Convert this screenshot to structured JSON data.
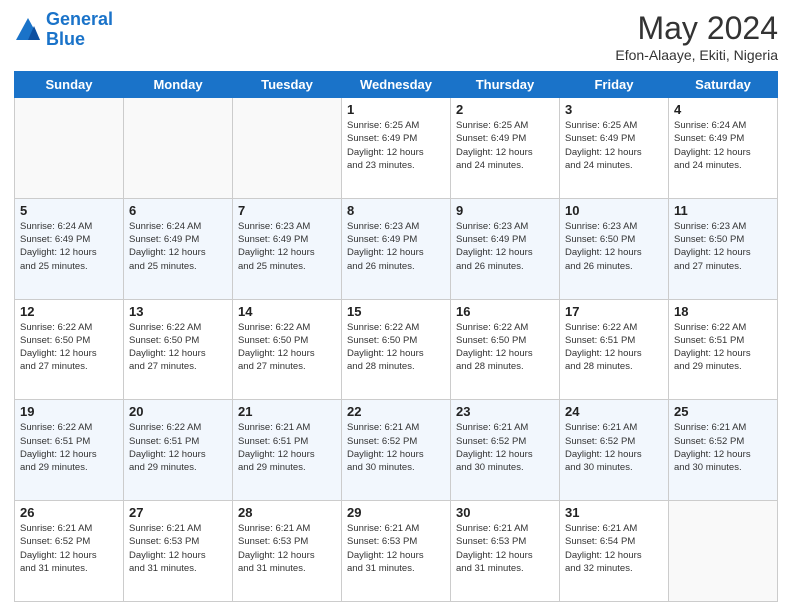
{
  "header": {
    "logo_line1": "General",
    "logo_line2": "Blue",
    "month_year": "May 2024",
    "location": "Efon-Alaaye, Ekiti, Nigeria"
  },
  "days_of_week": [
    "Sunday",
    "Monday",
    "Tuesday",
    "Wednesday",
    "Thursday",
    "Friday",
    "Saturday"
  ],
  "weeks": [
    [
      {
        "day": "",
        "info": ""
      },
      {
        "day": "",
        "info": ""
      },
      {
        "day": "",
        "info": ""
      },
      {
        "day": "1",
        "info": "Sunrise: 6:25 AM\nSunset: 6:49 PM\nDaylight: 12 hours\nand 23 minutes."
      },
      {
        "day": "2",
        "info": "Sunrise: 6:25 AM\nSunset: 6:49 PM\nDaylight: 12 hours\nand 24 minutes."
      },
      {
        "day": "3",
        "info": "Sunrise: 6:25 AM\nSunset: 6:49 PM\nDaylight: 12 hours\nand 24 minutes."
      },
      {
        "day": "4",
        "info": "Sunrise: 6:24 AM\nSunset: 6:49 PM\nDaylight: 12 hours\nand 24 minutes."
      }
    ],
    [
      {
        "day": "5",
        "info": "Sunrise: 6:24 AM\nSunset: 6:49 PM\nDaylight: 12 hours\nand 25 minutes."
      },
      {
        "day": "6",
        "info": "Sunrise: 6:24 AM\nSunset: 6:49 PM\nDaylight: 12 hours\nand 25 minutes."
      },
      {
        "day": "7",
        "info": "Sunrise: 6:23 AM\nSunset: 6:49 PM\nDaylight: 12 hours\nand 25 minutes."
      },
      {
        "day": "8",
        "info": "Sunrise: 6:23 AM\nSunset: 6:49 PM\nDaylight: 12 hours\nand 26 minutes."
      },
      {
        "day": "9",
        "info": "Sunrise: 6:23 AM\nSunset: 6:49 PM\nDaylight: 12 hours\nand 26 minutes."
      },
      {
        "day": "10",
        "info": "Sunrise: 6:23 AM\nSunset: 6:50 PM\nDaylight: 12 hours\nand 26 minutes."
      },
      {
        "day": "11",
        "info": "Sunrise: 6:23 AM\nSunset: 6:50 PM\nDaylight: 12 hours\nand 27 minutes."
      }
    ],
    [
      {
        "day": "12",
        "info": "Sunrise: 6:22 AM\nSunset: 6:50 PM\nDaylight: 12 hours\nand 27 minutes."
      },
      {
        "day": "13",
        "info": "Sunrise: 6:22 AM\nSunset: 6:50 PM\nDaylight: 12 hours\nand 27 minutes."
      },
      {
        "day": "14",
        "info": "Sunrise: 6:22 AM\nSunset: 6:50 PM\nDaylight: 12 hours\nand 27 minutes."
      },
      {
        "day": "15",
        "info": "Sunrise: 6:22 AM\nSunset: 6:50 PM\nDaylight: 12 hours\nand 28 minutes."
      },
      {
        "day": "16",
        "info": "Sunrise: 6:22 AM\nSunset: 6:50 PM\nDaylight: 12 hours\nand 28 minutes."
      },
      {
        "day": "17",
        "info": "Sunrise: 6:22 AM\nSunset: 6:51 PM\nDaylight: 12 hours\nand 28 minutes."
      },
      {
        "day": "18",
        "info": "Sunrise: 6:22 AM\nSunset: 6:51 PM\nDaylight: 12 hours\nand 29 minutes."
      }
    ],
    [
      {
        "day": "19",
        "info": "Sunrise: 6:22 AM\nSunset: 6:51 PM\nDaylight: 12 hours\nand 29 minutes."
      },
      {
        "day": "20",
        "info": "Sunrise: 6:22 AM\nSunset: 6:51 PM\nDaylight: 12 hours\nand 29 minutes."
      },
      {
        "day": "21",
        "info": "Sunrise: 6:21 AM\nSunset: 6:51 PM\nDaylight: 12 hours\nand 29 minutes."
      },
      {
        "day": "22",
        "info": "Sunrise: 6:21 AM\nSunset: 6:52 PM\nDaylight: 12 hours\nand 30 minutes."
      },
      {
        "day": "23",
        "info": "Sunrise: 6:21 AM\nSunset: 6:52 PM\nDaylight: 12 hours\nand 30 minutes."
      },
      {
        "day": "24",
        "info": "Sunrise: 6:21 AM\nSunset: 6:52 PM\nDaylight: 12 hours\nand 30 minutes."
      },
      {
        "day": "25",
        "info": "Sunrise: 6:21 AM\nSunset: 6:52 PM\nDaylight: 12 hours\nand 30 minutes."
      }
    ],
    [
      {
        "day": "26",
        "info": "Sunrise: 6:21 AM\nSunset: 6:52 PM\nDaylight: 12 hours\nand 31 minutes."
      },
      {
        "day": "27",
        "info": "Sunrise: 6:21 AM\nSunset: 6:53 PM\nDaylight: 12 hours\nand 31 minutes."
      },
      {
        "day": "28",
        "info": "Sunrise: 6:21 AM\nSunset: 6:53 PM\nDaylight: 12 hours\nand 31 minutes."
      },
      {
        "day": "29",
        "info": "Sunrise: 6:21 AM\nSunset: 6:53 PM\nDaylight: 12 hours\nand 31 minutes."
      },
      {
        "day": "30",
        "info": "Sunrise: 6:21 AM\nSunset: 6:53 PM\nDaylight: 12 hours\nand 31 minutes."
      },
      {
        "day": "31",
        "info": "Sunrise: 6:21 AM\nSunset: 6:54 PM\nDaylight: 12 hours\nand 32 minutes."
      },
      {
        "day": "",
        "info": ""
      }
    ]
  ]
}
